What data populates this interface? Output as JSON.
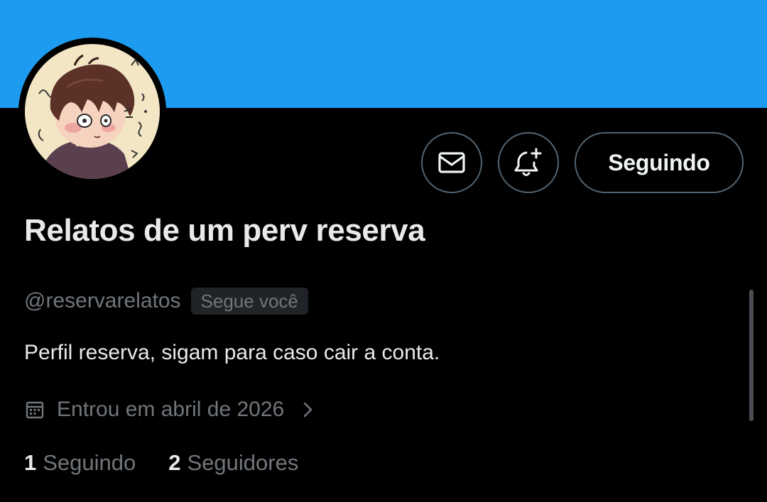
{
  "header": {
    "banner_color": "#1d9bf0"
  },
  "avatar": {
    "icon": "avatar-illustration"
  },
  "actions": {
    "message_icon": "envelope-icon",
    "notify_icon": "bell-plus-icon",
    "following_label": "Seguindo"
  },
  "profile": {
    "display_name": "Relatos de um perv reserva",
    "handle": "@reservarelatos",
    "follows_you": "Segue você",
    "bio": "Perfil reserva, sigam para caso cair a conta.",
    "joined": "Entrou em abril de 2026"
  },
  "stats": {
    "following_count": "1",
    "following_label": "Seguindo",
    "followers_count": "2",
    "followers_label": "Seguidores"
  },
  "colors": {
    "background": "#000000",
    "primary_text": "#e7e9ea",
    "secondary_text": "#71767b",
    "border": "#536471",
    "badge_bg": "#202327"
  }
}
